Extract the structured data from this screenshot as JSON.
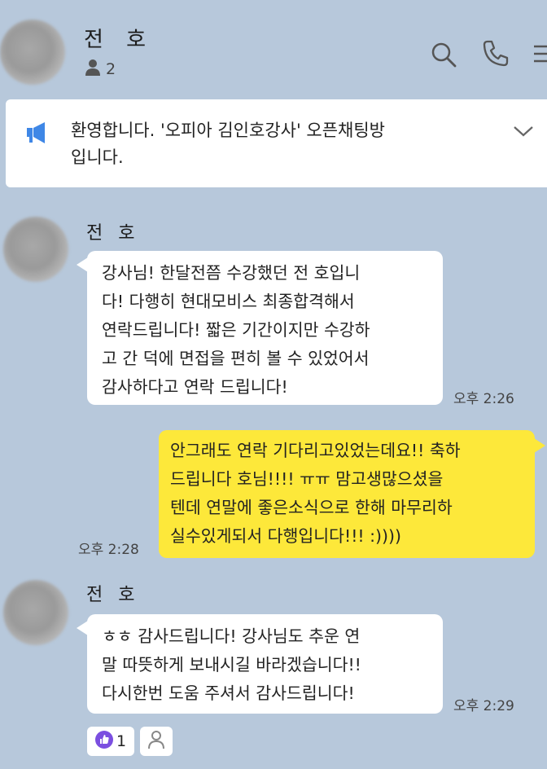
{
  "header": {
    "room_name": "전 호",
    "member_count": "2"
  },
  "notice": {
    "text": "환영합니다. '오피아 김인호강사' 오픈채팅방\n입니다."
  },
  "messages": [
    {
      "sender": "전 호",
      "text": "강사님! 한달전쯤 수강했던 전   호입니\n다! 다행히 현대모비스 최종합격해서\n연락드립니다! 짧은 기간이지만 수강하\n고 간 덕에 면접을 편히 볼 수 있었어서\n 감사하다고 연락 드립니다!",
      "time": "오후 2:26"
    },
    {
      "sender": "me",
      "text": "안그래도 연락 기다리고있었는데요!! 축하\n드립니다    호님!!!! ㅠㅠ 맘고생많으셨을\n텐데 연말에 좋은소식으로 한해 마무리하\n실수있게되서 다행입니다!!! :))))",
      "time": "오후 2:28"
    },
    {
      "sender": "전 호",
      "text": "ㅎㅎ 감사드립니다! 강사님도 추운 연\n말 따뜻하게 보내시길 바라겠습니다!!\n다시한번 도움 주셔서 감사드립니다!",
      "time": "오후 2:29",
      "reaction_count": "1"
    }
  ],
  "colors": {
    "background": "#b7c8db",
    "my_bubble": "#fde83a",
    "their_bubble": "#ffffff",
    "reaction_accent": "#7b4fe0",
    "notice_icon": "#3f87e6"
  }
}
